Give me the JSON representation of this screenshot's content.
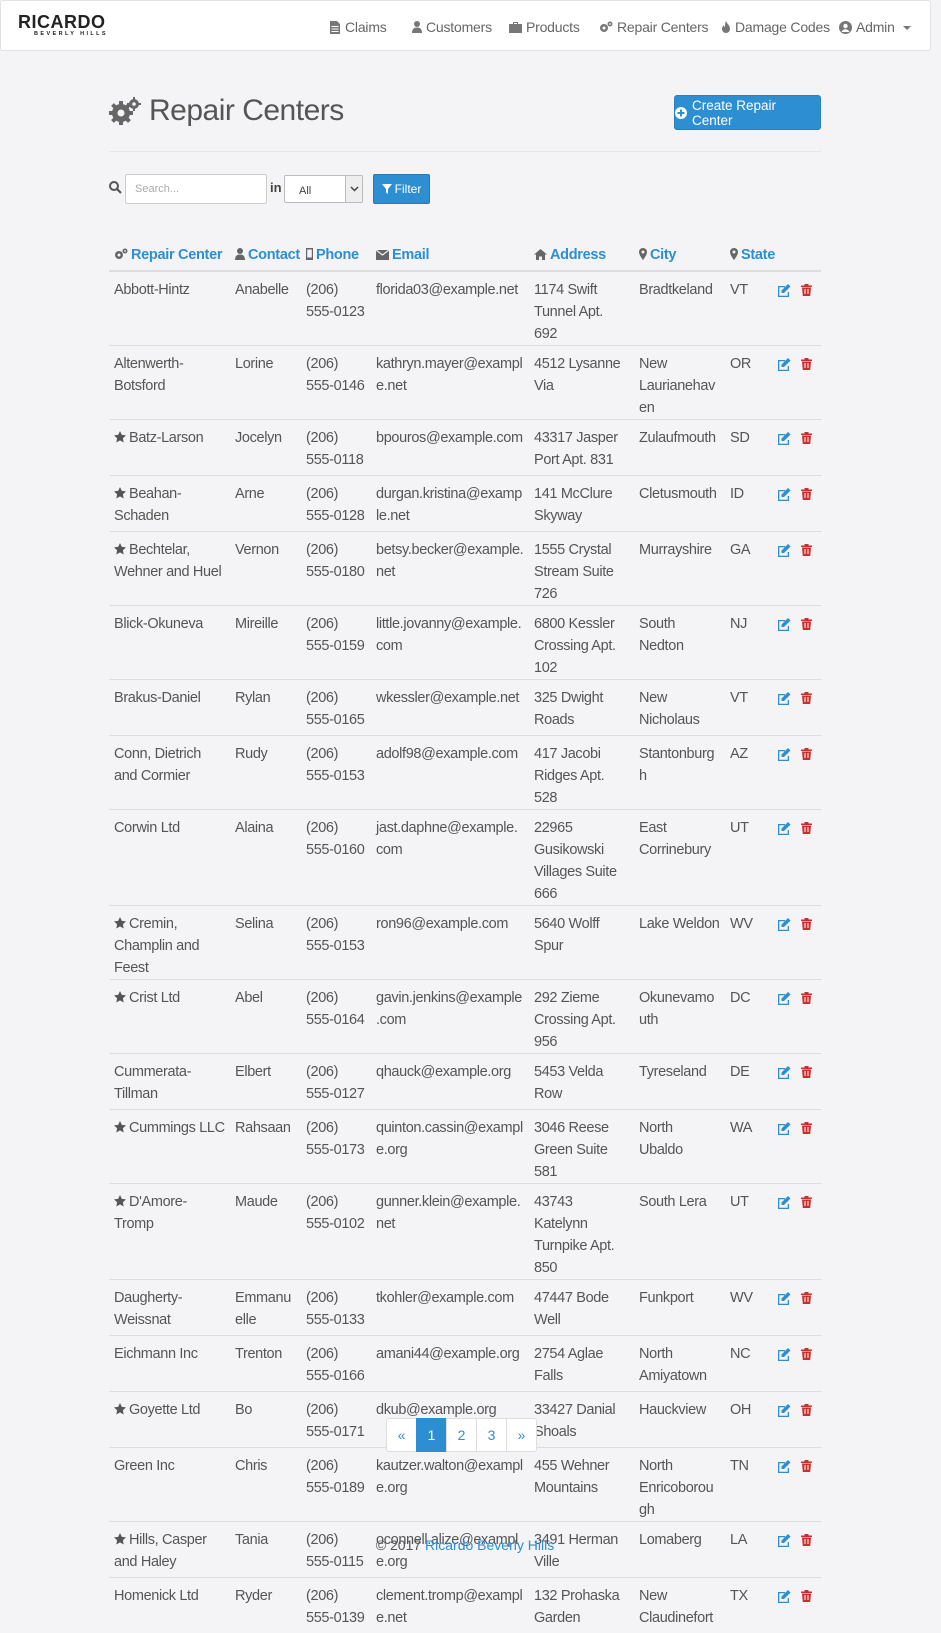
{
  "brand": {
    "name": "RICARDO",
    "sub": "BEVERLY HILLS"
  },
  "nav": [
    {
      "label": "Claims",
      "icon": "file-icon"
    },
    {
      "label": "Customers",
      "icon": "user-icon"
    },
    {
      "label": "Products",
      "icon": "briefcase-icon"
    },
    {
      "label": "Repair Centers",
      "icon": "gears-icon"
    },
    {
      "label": "Damage Codes",
      "icon": "fire-icon"
    },
    {
      "label": "Admin",
      "icon": "user-circle-icon"
    }
  ],
  "page": {
    "title": "Repair Centers",
    "create_label": "Create Repair Center"
  },
  "search": {
    "placeholder": "Search...",
    "in_label": "in",
    "scope": "All",
    "filter_label": "Filter"
  },
  "columns": [
    "Repair Center",
    "Contact",
    "Phone",
    "Email",
    "Address",
    "City",
    "State"
  ],
  "rows": [
    {
      "name": "Abbott-Hintz",
      "star": false,
      "contact": "Anabelle",
      "phone1": "(206)",
      "phone2": "555-0123",
      "email": "florida03@example.net",
      "address": "1174 Swift Tunnel Apt. 692",
      "city": "Bradtkeland",
      "state": "VT"
    },
    {
      "name": "Altenwerth-Botsford",
      "star": false,
      "contact": "Lorine",
      "phone1": "(206)",
      "phone2": "555-0146",
      "email": "kathryn.mayer@example.net",
      "address": "4512 Lysanne Via",
      "city": "New Laurianehaven",
      "state": "OR"
    },
    {
      "name": "Batz-Larson",
      "star": true,
      "contact": "Jocelyn",
      "phone1": "(206)",
      "phone2": "555-0118",
      "email": "bpouros@example.com",
      "address": "43317 Jasper Port Apt. 831",
      "city": "Zulaufmouth",
      "state": "SD"
    },
    {
      "name": "Beahan-Schaden",
      "star": true,
      "contact": "Arne",
      "phone1": "(206)",
      "phone2": "555-0128",
      "email": "durgan.kristina@example.net",
      "address": "141 McClure Skyway",
      "city": "Cletusmouth",
      "state": "ID"
    },
    {
      "name": "Bechtelar, Wehner and Huel",
      "star": true,
      "contact": "Vernon",
      "phone1": "(206)",
      "phone2": "555-0180",
      "email": "betsy.becker@example.net",
      "address": "1555 Crystal Stream Suite 726",
      "city": "Murrayshire",
      "state": "GA"
    },
    {
      "name": "Blick-Okuneva",
      "star": false,
      "contact": "Mireille",
      "phone1": "(206)",
      "phone2": "555-0159",
      "email": "little.jovanny@example.com",
      "address": "6800 Kessler Crossing Apt. 102",
      "city": "South Nedton",
      "state": "NJ"
    },
    {
      "name": "Brakus-Daniel",
      "star": false,
      "contact": "Rylan",
      "phone1": "(206)",
      "phone2": "555-0165",
      "email": "wkessler@example.net",
      "address": "325 Dwight Roads",
      "city": "New Nicholaus",
      "state": "VT"
    },
    {
      "name": "Conn, Dietrich and Cormier",
      "star": false,
      "contact": "Rudy",
      "phone1": "(206)",
      "phone2": "555-0153",
      "email": "adolf98@example.com",
      "address": "417 Jacobi Ridges Apt. 528",
      "city": "Stantonburgh",
      "state": "AZ"
    },
    {
      "name": "Corwin Ltd",
      "star": false,
      "contact": "Alaina",
      "phone1": "(206)",
      "phone2": "555-0160",
      "email": "jast.daphne@example.com",
      "address": "22965 Gusikowski Villages Suite 666",
      "city": "East Corrinebury",
      "state": "UT"
    },
    {
      "name": "Cremin, Champlin and Feest",
      "star": true,
      "contact": "Selina",
      "phone1": "(206)",
      "phone2": "555-0153",
      "email": "ron96@example.com",
      "address": "5640 Wolff Spur",
      "city": "Lake Weldon",
      "state": "WV"
    },
    {
      "name": "Crist Ltd",
      "star": true,
      "contact": "Abel",
      "phone1": "(206)",
      "phone2": "555-0164",
      "email": "gavin.jenkins@example.com",
      "address": "292 Zieme Crossing Apt. 956",
      "city": "Okunevamouth",
      "state": "DC"
    },
    {
      "name": "Cummerata-Tillman",
      "star": false,
      "contact": "Elbert",
      "phone1": "(206)",
      "phone2": "555-0127",
      "email": "qhauck@example.org",
      "address": "5453 Velda Row",
      "city": "Tyreseland",
      "state": "DE"
    },
    {
      "name": "Cummings LLC",
      "star": true,
      "contact": "Rahsaan",
      "phone1": "(206)",
      "phone2": "555-0173",
      "email": "quinton.cassin@example.org",
      "address": "3046 Reese Green Suite 581",
      "city": "North Ubaldo",
      "state": "WA"
    },
    {
      "name": "D'Amore-Tromp",
      "star": true,
      "contact": "Maude",
      "phone1": "(206)",
      "phone2": "555-0102",
      "email": "gunner.klein@example.net",
      "address": "43743 Katelynn Turnpike Apt. 850",
      "city": "South Lera",
      "state": "UT"
    },
    {
      "name": "Daugherty-Weissnat",
      "star": false,
      "contact": "Emmanuelle",
      "phone1": "(206)",
      "phone2": "555-0133",
      "email": "tkohler@example.com",
      "address": "47447 Bode Well",
      "city": "Funkport",
      "state": "WV"
    },
    {
      "name": "Eichmann Inc",
      "star": false,
      "contact": "Trenton",
      "phone1": "(206)",
      "phone2": "555-0166",
      "email": "amani44@example.org",
      "address": "2754 Aglae Falls",
      "city": "North Amiyatown",
      "state": "NC"
    },
    {
      "name": "Goyette Ltd",
      "star": true,
      "contact": "Bo",
      "phone1": "(206)",
      "phone2": "555-0171",
      "email": "dkub@example.org",
      "address": "33427 Danial Shoals",
      "city": "Hauckview",
      "state": "OH"
    },
    {
      "name": "Green Inc",
      "star": false,
      "contact": "Chris",
      "phone1": "(206)",
      "phone2": "555-0189",
      "email": "kautzer.walton@example.org",
      "address": "455 Wehner Mountains",
      "city": "North Enricoborough",
      "state": "TN"
    },
    {
      "name": "Hills, Casper and Haley",
      "star": true,
      "contact": "Tania",
      "phone1": "(206)",
      "phone2": "555-0115",
      "email": "oconnell.alize@example.org",
      "address": "3491 Herman Ville",
      "city": "Lomaberg",
      "state": "LA"
    },
    {
      "name": "Homenick Ltd",
      "star": false,
      "contact": "Ryder",
      "phone1": "(206)",
      "phone2": "555-0139",
      "email": "clement.tromp@example.net",
      "address": "132 Prohaska Garden",
      "city": "New Claudinefort",
      "state": "TX"
    }
  ],
  "pagination": {
    "prev": "«",
    "pages": [
      "1",
      "2",
      "3"
    ],
    "current": "1",
    "next": "»"
  },
  "footer": {
    "copyright": "© 2017",
    "company": "Ricardo Beverly Hills"
  },
  "colors": {
    "accent": "#2e8ed2",
    "danger": "#c9302c",
    "text": "#555555"
  }
}
